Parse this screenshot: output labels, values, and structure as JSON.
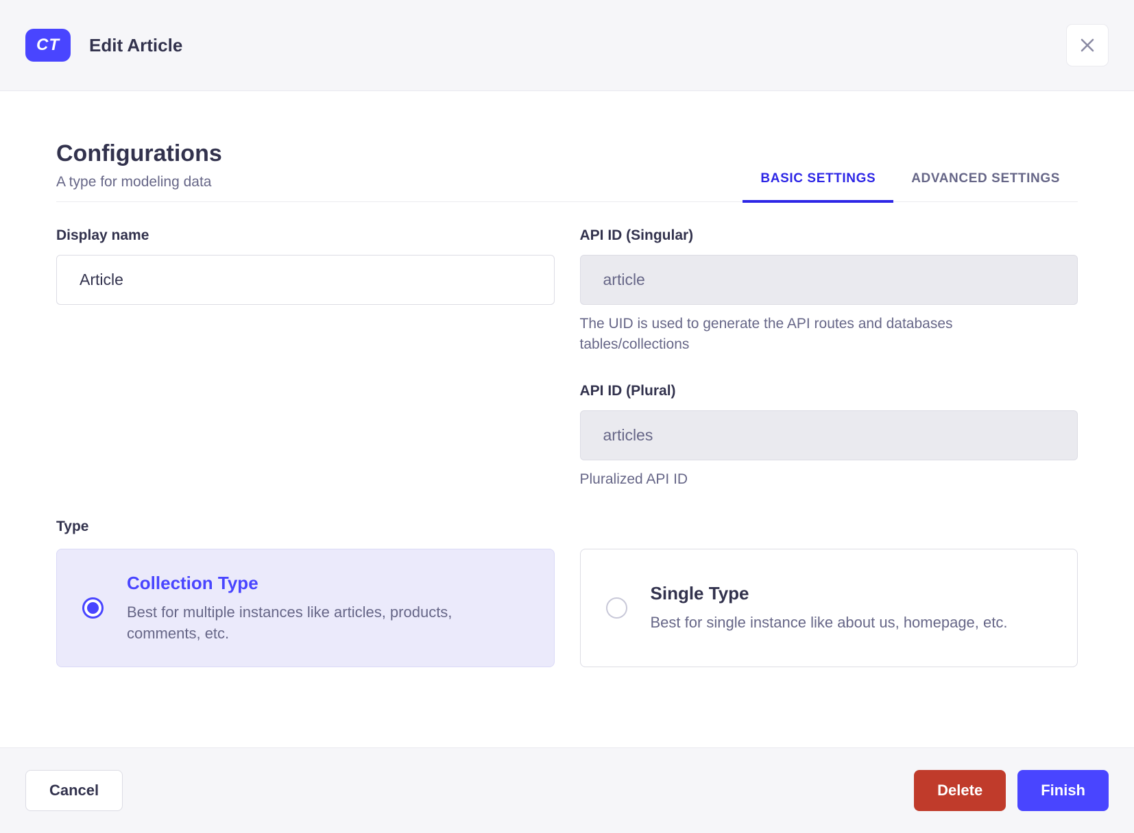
{
  "header": {
    "badge": "CT",
    "title": "Edit Article"
  },
  "configurations": {
    "title": "Configurations",
    "subtitle": "A type for modeling data",
    "tabs": [
      {
        "label": "BASIC SETTINGS",
        "active": true
      },
      {
        "label": "ADVANCED SETTINGS",
        "active": false
      }
    ]
  },
  "form": {
    "display_name": {
      "label": "Display name",
      "value": "Article"
    },
    "api_id_singular": {
      "label": "API ID (Singular)",
      "value": "article",
      "hint": "The UID is used to generate the API routes and databases tables/collections"
    },
    "api_id_plural": {
      "label": "API ID (Plural)",
      "value": "articles",
      "hint": "Pluralized API ID"
    },
    "type": {
      "label": "Type",
      "options": [
        {
          "title": "Collection Type",
          "description": "Best for multiple instances like articles, products, comments, etc.",
          "selected": true
        },
        {
          "title": "Single Type",
          "description": "Best for single instance like about us, homepage, etc.",
          "selected": false
        }
      ]
    }
  },
  "footer": {
    "cancel_label": "Cancel",
    "delete_label": "Delete",
    "finish_label": "Finish"
  },
  "colors": {
    "primary": "#4945FF",
    "tab_active": "#2D26E6",
    "danger": "#C03B2B",
    "text": "#32324D",
    "muted": "#666687",
    "surface": "#F6F6F9",
    "border": "#DCDCE4",
    "disabled_bg": "#EAEAEF",
    "selected_card_bg": "#EBEAFB"
  }
}
